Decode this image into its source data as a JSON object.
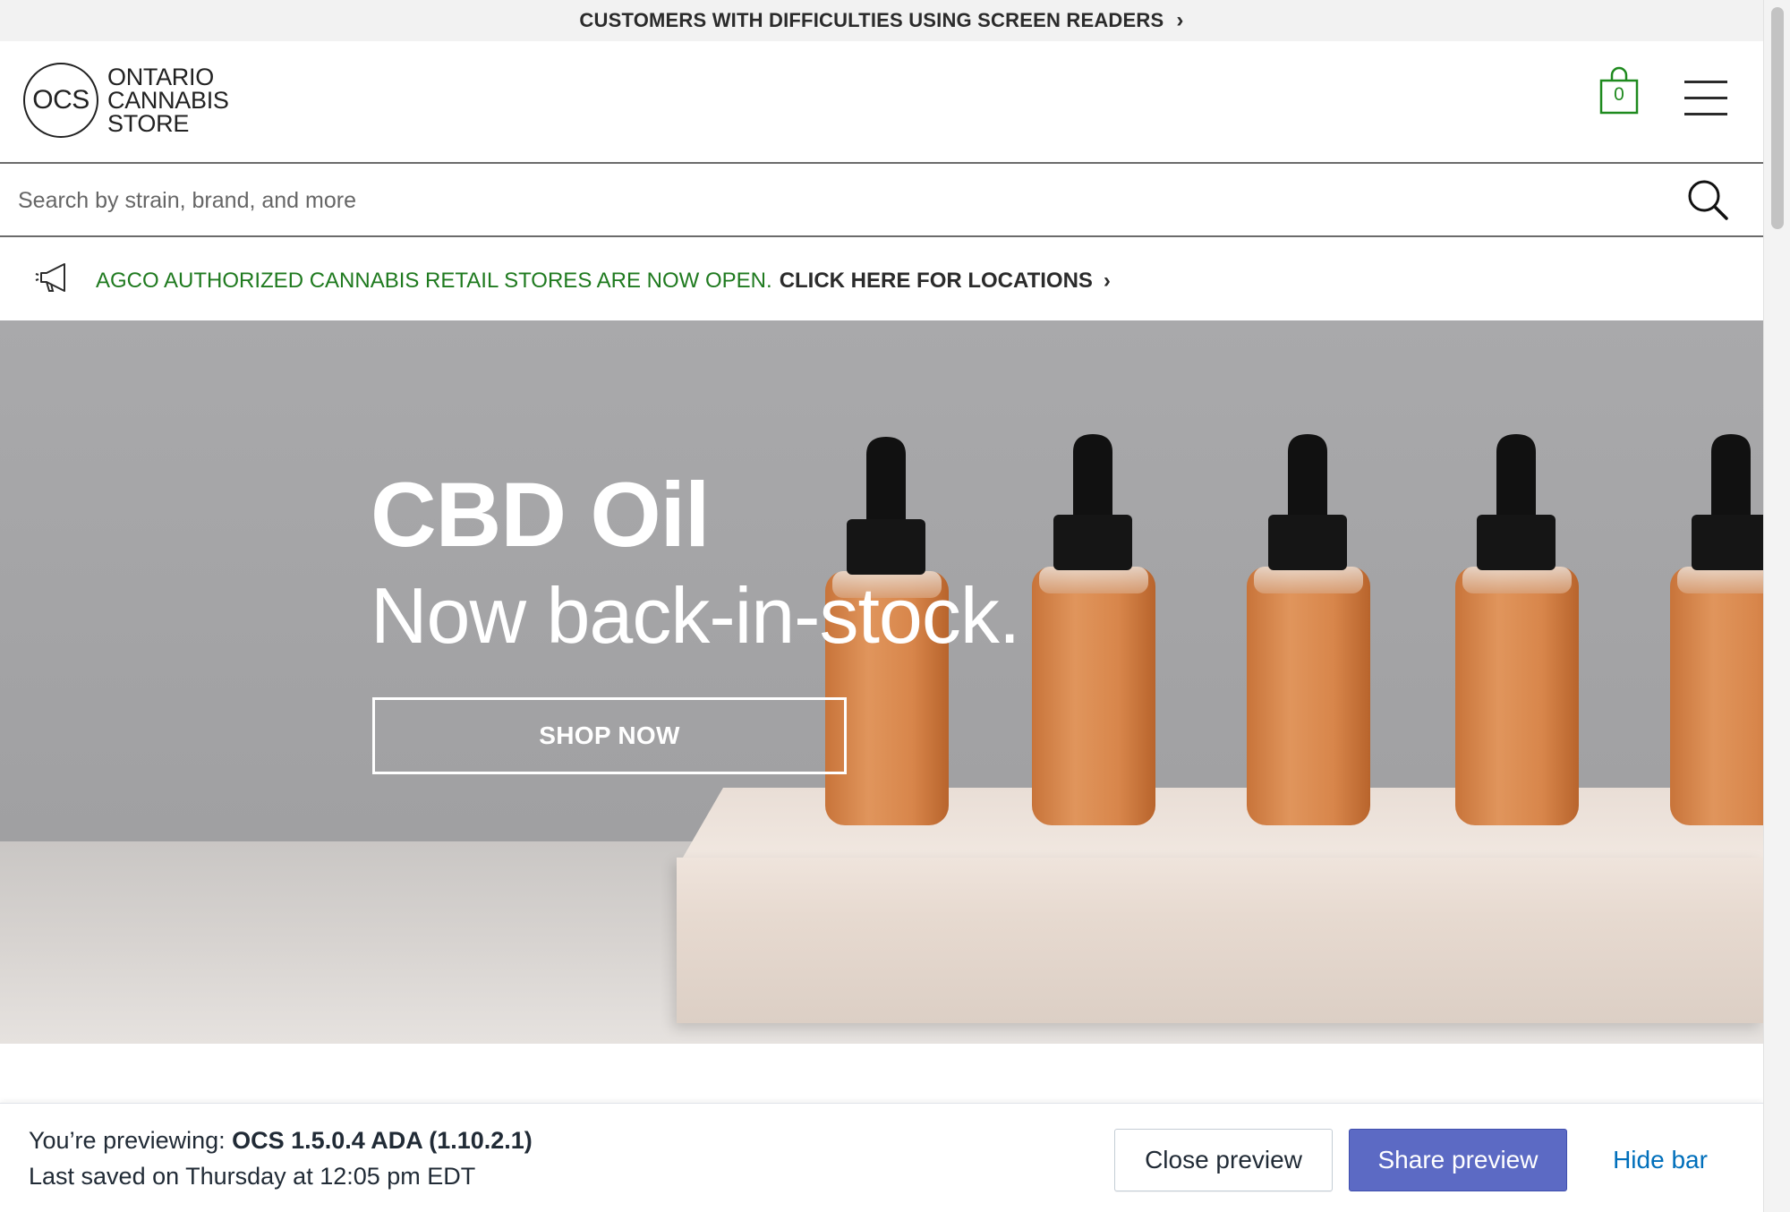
{
  "accessibility_bar": {
    "text": "CUSTOMERS WITH DIFFICULTIES USING SCREEN READERS",
    "chevron": "›"
  },
  "header": {
    "logo": {
      "mark": "OCS",
      "line1": "ONTARIO",
      "line2": "CANNABIS",
      "line3": "STORE"
    },
    "cart": {
      "count": "0",
      "icon": "shopping-bag-icon"
    },
    "menu_icon": "hamburger-menu-icon"
  },
  "search": {
    "placeholder": "Search by strain, brand, and more",
    "value": "",
    "icon": "search-icon"
  },
  "announcement": {
    "icon": "megaphone-icon",
    "highlight": "AGCO AUTHORIZED CANNABIS RETAIL STORES ARE NOW OPEN.",
    "link": "CLICK HERE FOR LOCATIONS",
    "chevron": "›"
  },
  "hero": {
    "title": "CBD Oil",
    "subtitle": "Now back-in-stock.",
    "button": "SHOP NOW"
  },
  "preview_bar": {
    "previewing_label": "You’re previewing:",
    "theme_name": "OCS 1.5.0.4 ADA (1.10.2.1)",
    "last_saved": "Last saved on Thursday at 12:05 pm EDT",
    "close_button": "Close preview",
    "share_button": "Share preview",
    "hide_button": "Hide bar"
  },
  "colors": {
    "brand_green": "#1f7a1f",
    "cart_green": "#1e8a1e",
    "share_button": "#5c6ac4",
    "hide_link": "#006fbb"
  }
}
